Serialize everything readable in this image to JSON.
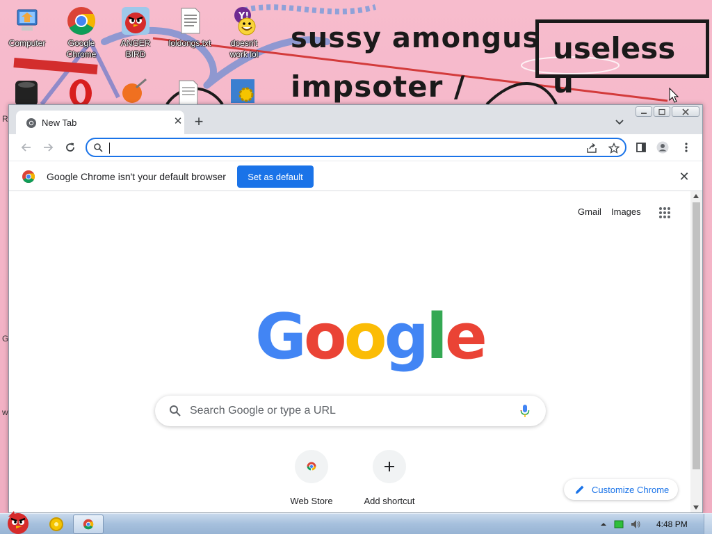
{
  "wallpaper": {
    "line1": "sussy amongus",
    "line2": "impsoter /",
    "box_text": "useless u"
  },
  "desktop": {
    "icons": [
      {
        "label": "Computer",
        "icon": "computer-icon"
      },
      {
        "label": "Google\nChrome",
        "icon": "chrome-icon"
      },
      {
        "label": "ANGER\nBIRD",
        "icon": "angry-bird-icon"
      },
      {
        "label": "loldongs.txt",
        "icon": "text-file-icon"
      },
      {
        "label": "doesn't\nwork lol",
        "icon": "yahoo-messenger-icon"
      }
    ],
    "edge_letters": [
      "R",
      "G",
      "w"
    ]
  },
  "browser": {
    "tab": {
      "title": "New Tab"
    },
    "omnibox": {
      "value": "",
      "placeholder": ""
    },
    "infobar": {
      "message": "Google Chrome isn't your default browser",
      "button_label": "Set as default"
    },
    "ntp": {
      "gmail_label": "Gmail",
      "images_label": "Images",
      "logo_letters": [
        {
          "char": "G",
          "color": "#4285f4"
        },
        {
          "char": "o",
          "color": "#ea4335"
        },
        {
          "char": "o",
          "color": "#fbbc05"
        },
        {
          "char": "g",
          "color": "#4285f4"
        },
        {
          "char": "l",
          "color": "#34a853"
        },
        {
          "char": "e",
          "color": "#ea4335"
        }
      ],
      "search_placeholder": "Search Google or type a URL",
      "shortcuts": [
        {
          "label": "Web Store",
          "icon": "web-store-icon"
        },
        {
          "label": "Add shortcut",
          "icon": "plus-icon"
        }
      ],
      "customize_label": "Customize Chrome"
    }
  },
  "taskbar": {
    "clock": "4:48 PM"
  },
  "colors": {
    "accent": "#1a73e8",
    "wallpaper": "#f4b7c9",
    "taskbar": "#a6c0dd"
  }
}
